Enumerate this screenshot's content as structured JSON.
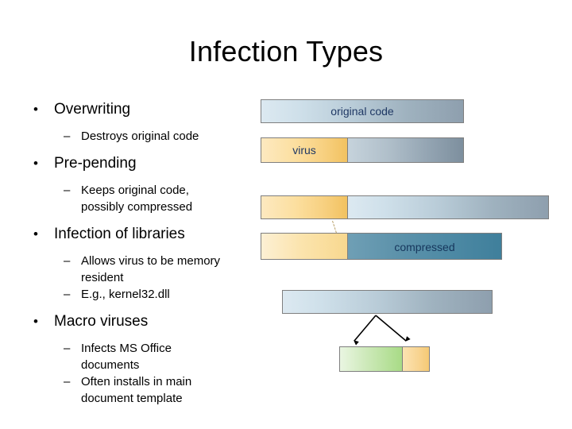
{
  "slide": {
    "title": "Infection Types",
    "bullets": [
      {
        "level": 1,
        "marker": "•",
        "text": "Overwriting"
      },
      {
        "level": 2,
        "marker": "–",
        "text": "Destroys original code"
      },
      {
        "level": 1,
        "marker": "•",
        "text": "Pre-pending"
      },
      {
        "level": 2,
        "marker": "–",
        "text": "Keeps original code,"
      },
      {
        "level": 2,
        "marker": "",
        "text": "possibly compressed"
      },
      {
        "level": 1,
        "marker": "•",
        "text": "Infection of libraries"
      },
      {
        "level": 2,
        "marker": "–",
        "text": "Allows virus to be memory"
      },
      {
        "level": 2,
        "marker": "",
        "text": "resident"
      },
      {
        "level": 2,
        "marker": "–",
        "text": "E.g., kernel32.dll"
      },
      {
        "level": 1,
        "marker": "•",
        "text": "Macro viruses"
      },
      {
        "level": 2,
        "marker": "–",
        "text": "Infects MS Office"
      },
      {
        "level": 2,
        "marker": "",
        "text": "documents"
      },
      {
        "level": 2,
        "marker": "–",
        "text": "Often installs in main"
      },
      {
        "level": 2,
        "marker": "",
        "text": "document template"
      }
    ],
    "diagram": {
      "labels": {
        "original_code": "original code",
        "virus": "virus",
        "compressed": "compressed"
      },
      "colors": {
        "label_text": "#1f3864",
        "bar_border": "#7f7f7f",
        "virus_fill_start": "#fde9c0",
        "virus_fill_end": "#f2c260",
        "compressed_fill_start": "#6f9fb5",
        "compressed_fill_end": "#3f7f9b",
        "code_fill_start": "#dce9f1",
        "code_fill_end": "#8e9fae",
        "macro_fill_start": "#eaf6e2",
        "macro_fill_end": "#a8db86"
      }
    }
  }
}
